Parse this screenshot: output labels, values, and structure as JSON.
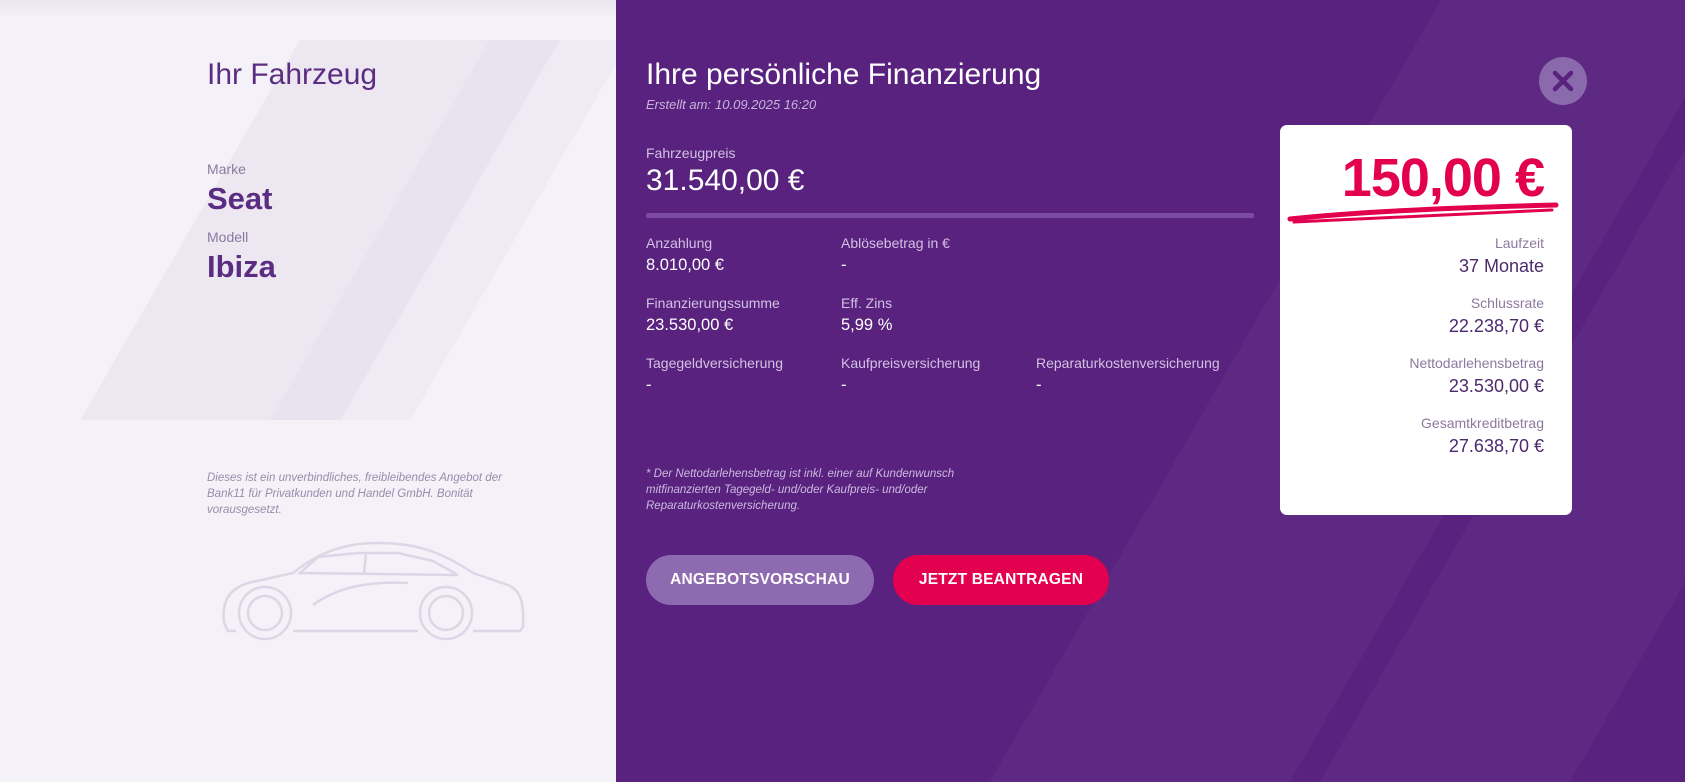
{
  "vehicle": {
    "title": "Ihr Fahrzeug",
    "brand_label": "Marke",
    "brand": "Seat",
    "model_label": "Modell",
    "model": "Ibiza",
    "disclaimer": "Dieses ist ein unverbindliches, freibleibendes Angebot der Bank11 für Privatkunden und Handel GmbH. Bonität vorausgesetzt."
  },
  "financing": {
    "title": "Ihre persönliche Finanzierung",
    "created_label": "Erstellt am:",
    "created_value": "10.09.2025 16:20",
    "price_label": "Fahrzeugpreis",
    "price": "31.540,00 €",
    "fields": {
      "anzahlung_label": "Anzahlung",
      "anzahlung": "8.010,00 €",
      "abloese_label": "Ablösebetrag in €",
      "abloese": "-",
      "finsumme_label": "Finanzierungssumme",
      "finsumme": "23.530,00 €",
      "zins_label": "Eff. Zins",
      "zins": "5,99 %",
      "tagegeld_label": "Tagegeldversicherung",
      "tagegeld": "-",
      "kaufpreis_label": "Kaufpreisversicherung",
      "kaufpreis": "-",
      "reparatur_label": "Reparaturkostenversicherung",
      "reparatur": "-"
    },
    "footnote": "* Der Nettodarlehensbetrag ist inkl. einer auf Kundenwunsch mitfinanzierten Tagegeld- und/oder Kaufpreis- und/oder Reparaturkostenversicherung."
  },
  "buttons": {
    "preview": "ANGEBOTSVORSCHAU",
    "apply": "JETZT BEANTRAGEN"
  },
  "summary": {
    "rate": "150,00 €",
    "laufzeit_label": "Laufzeit",
    "laufzeit": "37 Monate",
    "schlussrate_label": "Schlussrate",
    "schlussrate": "22.238,70 €",
    "netto_label": "Nettodarlehensbetrag",
    "netto": "23.530,00 €",
    "gesamt_label": "Gesamtkreditbetrag",
    "gesamt": "27.638,70 €"
  },
  "icons": {
    "close": "close-icon",
    "car": "car-icon"
  },
  "colors": {
    "primary_purple": "#58227e",
    "accent_pink": "#e2004f",
    "light_bg": "#f4f1f8"
  }
}
